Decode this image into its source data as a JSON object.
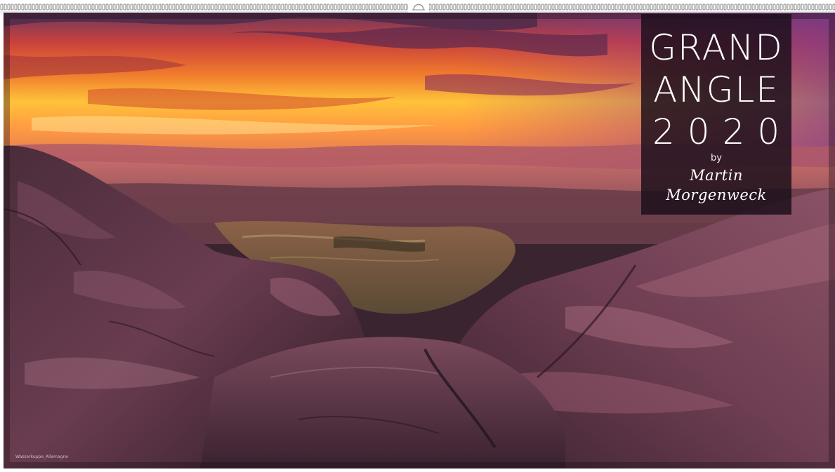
{
  "calendar": {
    "title_line1": "GRAND",
    "title_line2": "ANGLE",
    "year": "2020",
    "by": "by",
    "author": "Martin Morgenweck",
    "photo_caption": "Wasserkuppe_Allemagne"
  },
  "icons": {
    "binding": "spiral-wire-binding",
    "hanger": "hanger-hook-icon"
  }
}
